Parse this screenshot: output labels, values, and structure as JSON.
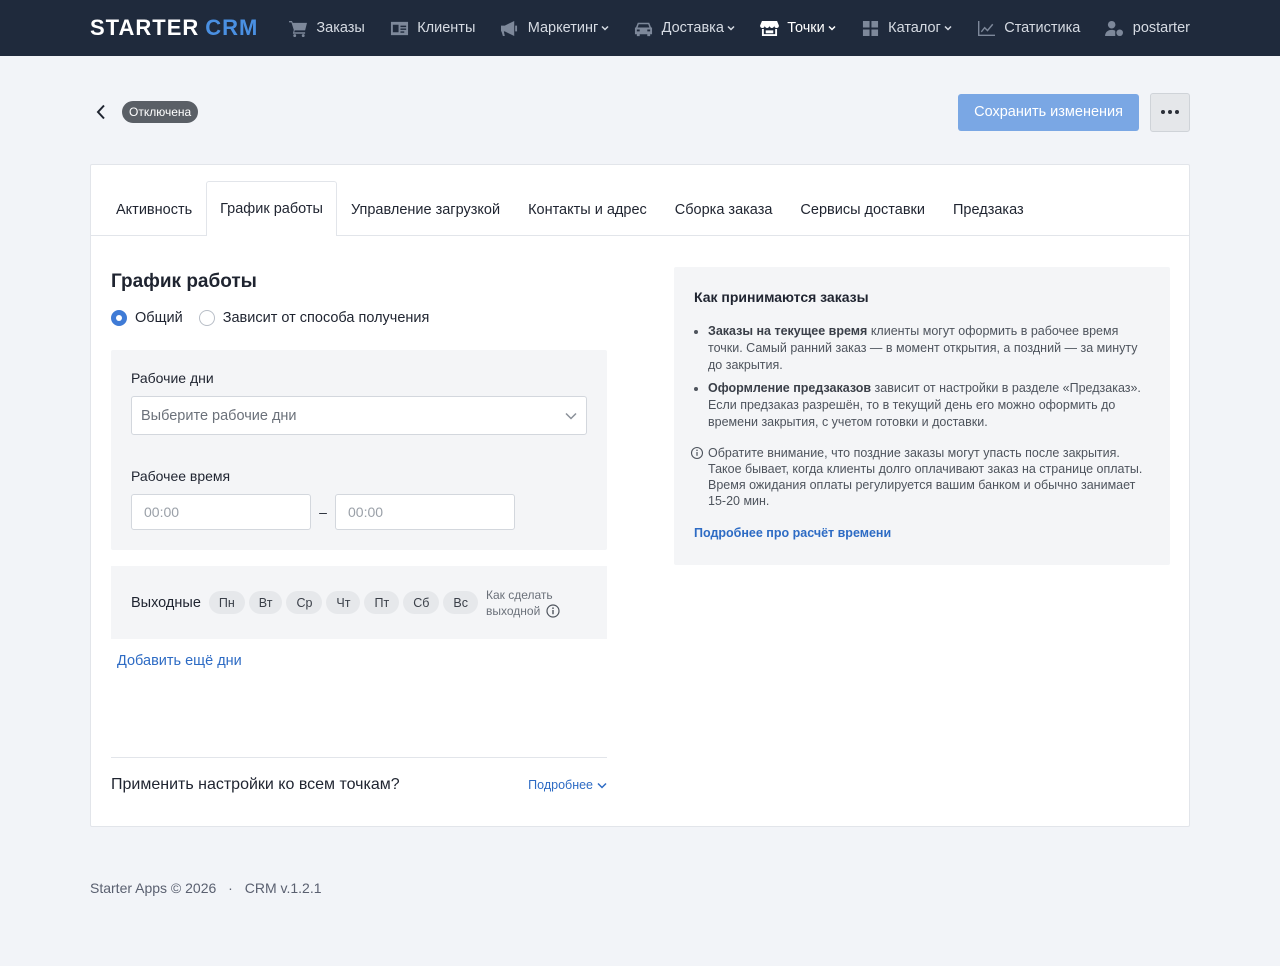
{
  "topbar": {
    "logo_main": "STARTER",
    "logo_accent": "CRM",
    "nav": [
      {
        "label": "Заказы",
        "icon": "cart-icon",
        "dropdown": false
      },
      {
        "label": "Клиенты",
        "icon": "id-card-icon",
        "dropdown": false
      },
      {
        "label": "Маркетинг",
        "icon": "megaphone-icon",
        "dropdown": true
      },
      {
        "label": "Доставка",
        "icon": "car-icon",
        "dropdown": true
      },
      {
        "label": "Точки",
        "icon": "store-icon",
        "dropdown": true,
        "active": true
      },
      {
        "label": "Каталог",
        "icon": "grid-icon",
        "dropdown": true
      },
      {
        "label": "Статистика",
        "icon": "chart-icon",
        "dropdown": false
      },
      {
        "label": "postarter",
        "icon": "user-gear-icon",
        "dropdown": false
      }
    ]
  },
  "header": {
    "status": "Отключена",
    "save_label": "Сохранить изменения"
  },
  "tabs": [
    "Активность",
    "График работы",
    "Управление загрузкой",
    "Контакты и адрес",
    "Сборка заказа",
    "Сервисы доставки",
    "Предзаказ"
  ],
  "active_tab": "График работы",
  "schedule": {
    "title": "График работы",
    "mode_common": "Общий",
    "mode_by_method": "Зависит от способа получения",
    "work_days_label": "Рабочие дни",
    "work_days_placeholder": "Выберите рабочие дни",
    "work_time_label": "Рабочее время",
    "time_from_placeholder": "00:00",
    "time_to_placeholder": "00:00",
    "time_separator": "–",
    "weekends_label": "Выходные",
    "days": [
      "Пн",
      "Вт",
      "Ср",
      "Чт",
      "Пт",
      "Сб",
      "Вс"
    ],
    "weekend_help_line1": "Как сделать",
    "weekend_help_line2": "выходной",
    "add_days": "Добавить ещё дни",
    "apply_title": "Применить настройки ко всем точкам?",
    "apply_more": "Подробнее"
  },
  "info": {
    "title": "Как принимаются заказы",
    "item1_bold": "Заказы на текущее время",
    "item1_text": " клиенты могут оформить в рабочее время точки. Самый ранний заказ — в момент открытия, а поздний — за минуту до закрытия.",
    "item2_bold": "Оформление предзаказов",
    "item2_text": " зависит от настройки в разделе «Предзаказ». Если предзаказ разрешён, то в текущий день его можно оформить до времени закрытия, с учетом готовки и доставки.",
    "note": "Обратите внимание, что поздние заказы могут упасть после закрытия. Такое бывает, когда клиенты долго оплачивают заказ на странице оплаты. Время ожидания оплаты регулируется вашим банком и обычно занимает 15-20 мин.",
    "link": "Подробнее про расчёт времени"
  },
  "footer": {
    "copyright": "Starter Apps © 2026",
    "separator": "·",
    "version": "CRM v.1.2.1"
  },
  "colors": {
    "topbar": "#1f2a3c",
    "accent": "#4a90e2",
    "link": "#2d6bc4",
    "save_button": "#7aa7e4",
    "badge": "#5a5f66"
  }
}
